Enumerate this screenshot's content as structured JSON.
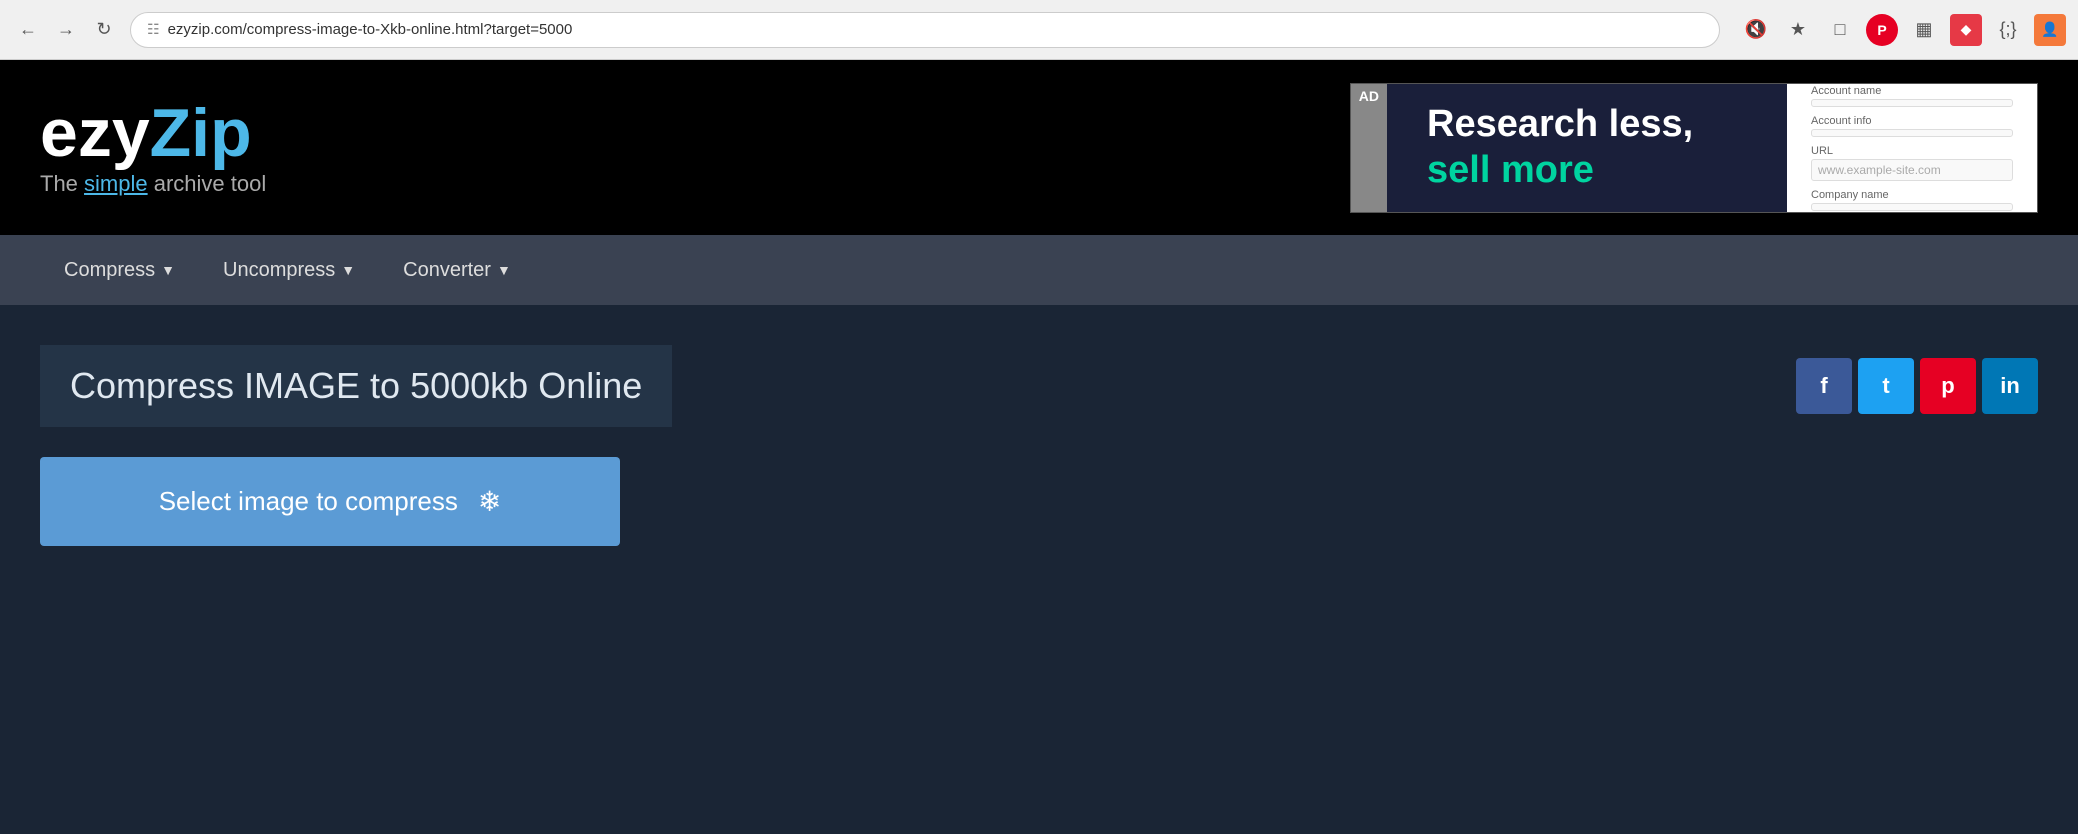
{
  "browser": {
    "url": "ezyzip.com/compress-image-to-Xkb-online.html?target=5000",
    "back_title": "Back",
    "forward_title": "Forward",
    "reload_title": "Reload"
  },
  "header": {
    "logo_ezy": "ezy",
    "logo_zip": "Zip",
    "tagline_prefix": "The ",
    "tagline_simple": "simple",
    "tagline_suffix": " archive tool"
  },
  "ad": {
    "label": "AD",
    "headline_line1": "Research less,",
    "headline_line2": "sell more",
    "form": {
      "account_name_label": "Account name",
      "account_name_placeholder": "",
      "account_info_label": "Account info",
      "url_label": "URL",
      "url_placeholder": "www.example-site.com",
      "company_name_label": "Company name"
    }
  },
  "nav": {
    "compress_label": "Compress",
    "uncompress_label": "Uncompress",
    "converter_label": "Converter"
  },
  "main": {
    "page_title": "Compress IMAGE to 5000kb Online",
    "upload_button_label": "Select image to compress",
    "social": {
      "facebook_label": "f",
      "twitter_label": "t",
      "pinterest_label": "p",
      "linkedin_label": "in"
    }
  }
}
